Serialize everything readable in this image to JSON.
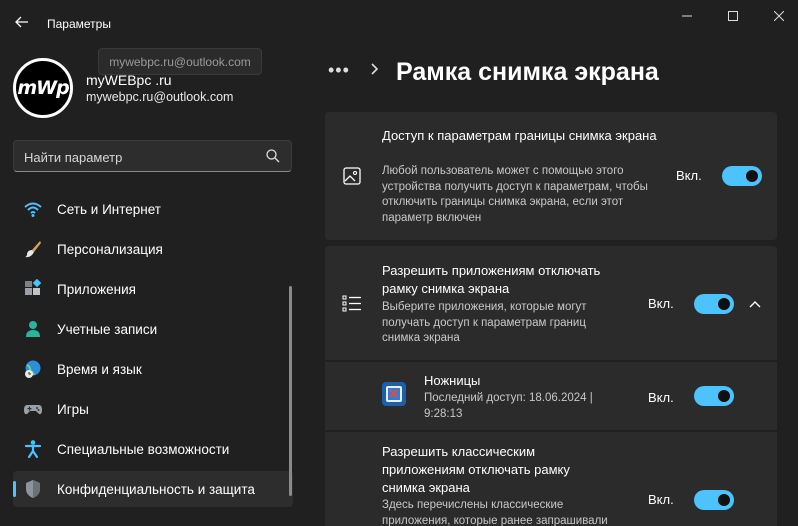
{
  "window": {
    "title": "Параметры",
    "tooltip": "mywebpc.ru@outlook.com"
  },
  "profile": {
    "avatar_text": "mWp",
    "name": "myWEBpc .ru",
    "email": "mywebpc.ru@outlook.com"
  },
  "search": {
    "placeholder": "Найти параметр"
  },
  "sidebar": {
    "items": [
      {
        "label": "Сеть и Интернет",
        "icon": "wifi-icon"
      },
      {
        "label": "Персонализация",
        "icon": "brush-icon"
      },
      {
        "label": "Приложения",
        "icon": "apps-icon"
      },
      {
        "label": "Учетные записи",
        "icon": "person-icon"
      },
      {
        "label": "Время и язык",
        "icon": "globe-clock-icon"
      },
      {
        "label": "Игры",
        "icon": "gamepad-icon"
      },
      {
        "label": "Специальные возможности",
        "icon": "accessibility-icon"
      },
      {
        "label": "Конфиденциальность и защита",
        "icon": "shield-icon",
        "active": true
      }
    ]
  },
  "page": {
    "breadcrumb_more": "•••",
    "title": "Рамка снимка экрана"
  },
  "settings": [
    {
      "title": "Доступ к параметрам границы снимка экрана",
      "description": "Любой пользователь может с помощью этого устройства получить доступ к параметрам, чтобы отключить границы снимка экрана, если этот параметр включен",
      "state": "Вкл.",
      "on": true,
      "icon": "image-frame-icon"
    },
    {
      "title": "Разрешить приложениям отключать рамку снимка экрана",
      "description": "Выберите приложения, которые могут получать доступ к параметрам границ снимка экрана",
      "state": "Вкл.",
      "on": true,
      "icon": "list-icon",
      "expanded": true
    },
    {
      "title": "Ножницы",
      "description": "Последний доступ: 18.06.2024 | 9:28:13",
      "state": "Вкл.",
      "on": true,
      "icon": "snipping-tool-icon"
    },
    {
      "title": "Разрешить классическим приложениям отключать рамку снимка экрана",
      "description": "Здесь перечислены классические приложения, которые ранее запрашивали",
      "state": "Вкл.",
      "on": true
    }
  ],
  "colors": {
    "accent": "#4cc2ff",
    "background": "#202020",
    "card": "#2b2b2b"
  }
}
